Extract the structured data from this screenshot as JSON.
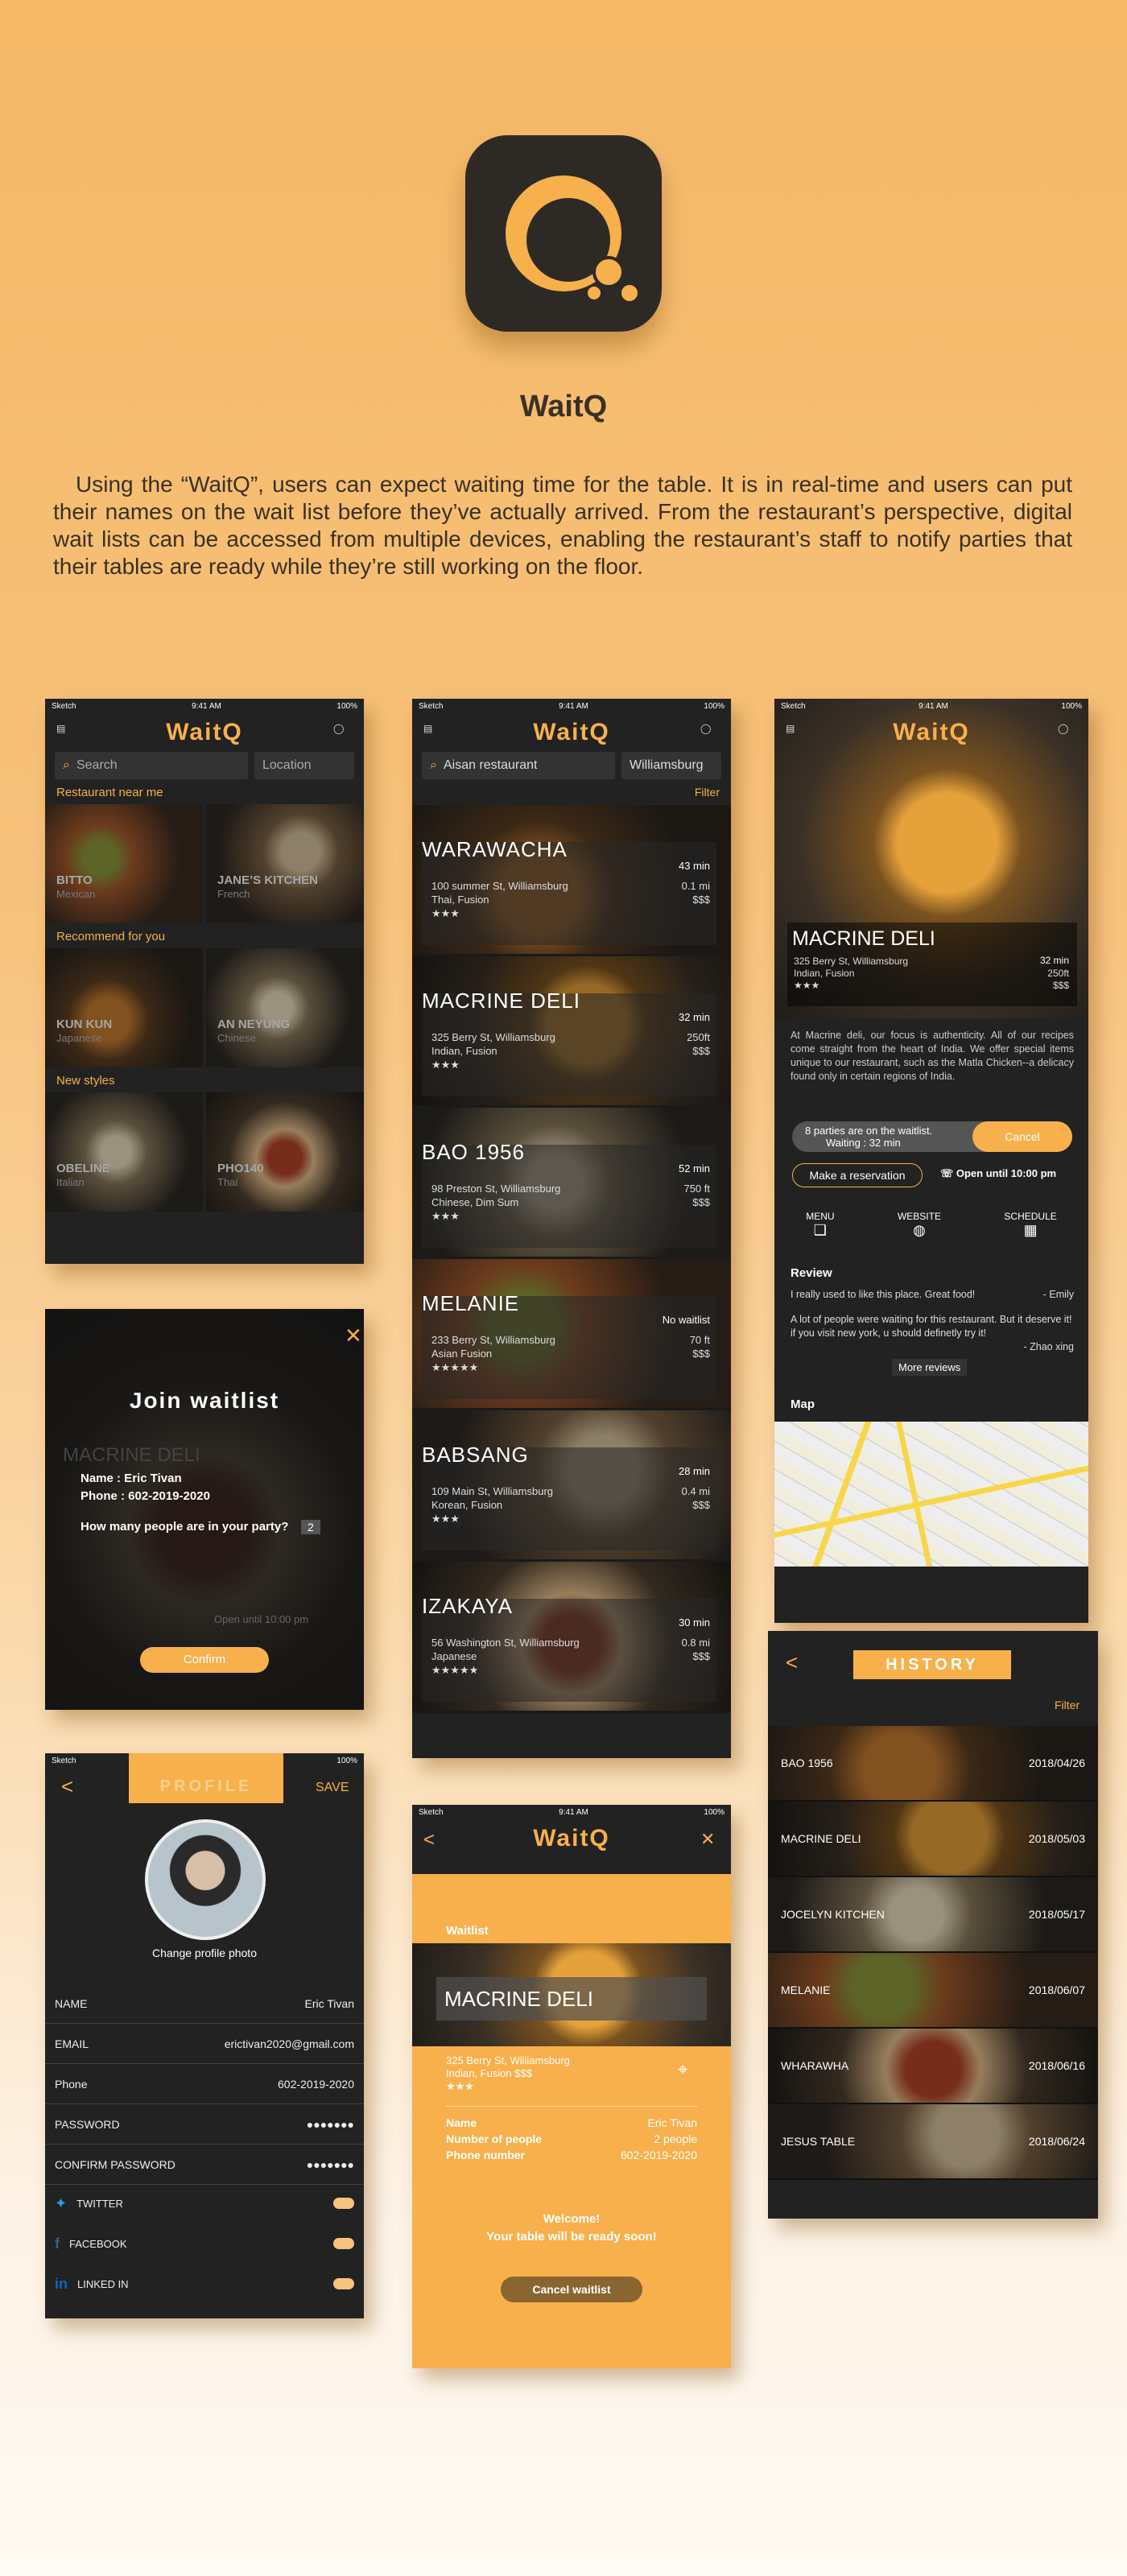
{
  "hero": {
    "app_name": "WaitQ",
    "description": "Using the “WaitQ”, users can expect waiting time for the table. It is in real-time and users can put their names on the wait list before they’ve actually arrived. From the restaurant’s perspective, digital wait lists can be accessed from multiple devices, enabling the restaurant’s staff to notify parties that their tables are ready while they’re still working on the floor."
  },
  "status": {
    "carrier": "Sketch",
    "time": "9:41 AM",
    "battery": "100%"
  },
  "home": {
    "title": "WaitQ",
    "search_placeholder": "Search",
    "location_placeholder": "Location",
    "sections": [
      {
        "label": "Restaurant near me",
        "items": [
          {
            "name": "BITTO",
            "cuisine": "Mexican"
          },
          {
            "name": "JANE’S KITCHEN",
            "cuisine": "French"
          }
        ]
      },
      {
        "label": "Recommend for you",
        "items": [
          {
            "name": "KUN KUN",
            "cuisine": "Japanese"
          },
          {
            "name": "AN NEYUNG",
            "cuisine": "Chinese"
          }
        ]
      },
      {
        "label": "New styles",
        "items": [
          {
            "name": "OBELINE",
            "cuisine": "Italian"
          },
          {
            "name": "PHO140",
            "cuisine": "Thai"
          }
        ]
      }
    ]
  },
  "list": {
    "title": "WaitQ",
    "search_value": "Aisan restaurant",
    "location_value": "Williamsburg",
    "filter": "Filter",
    "cards": [
      {
        "name": "WARAWACHA",
        "time": "43 min",
        "address": "100 summer St, Williamsburg",
        "cuisine": "Thai, Fusion",
        "distance": "0.1 mi",
        "price": "$$$",
        "stars": "★★★"
      },
      {
        "name": "MACRINE DELI",
        "time": "32 min",
        "address": "325 Berry St, Williamsburg",
        "cuisine": "Indian, Fusion",
        "distance": "250ft",
        "price": "$$$",
        "stars": "★★★"
      },
      {
        "name": "BAO 1956",
        "time": "52 min",
        "address": "98 Preston St, Williamsburg",
        "cuisine": "Chinese, Dim Sum",
        "distance": "750 ft",
        "price": "$$$",
        "stars": "★★★"
      },
      {
        "name": "MELANIE",
        "time": "No waitlist",
        "address": "233 Berry St, Williamsburg",
        "cuisine": "Asian Fusion",
        "distance": "70 ft",
        "price": "$$$",
        "stars": "★★★★★"
      },
      {
        "name": "BABSANG",
        "time": "28 min",
        "address": "109 Main St, Williamsburg",
        "cuisine": "Korean, Fusion",
        "distance": "0.4 mi",
        "price": "$$$",
        "stars": "★★★"
      },
      {
        "name": "IZAKAYA",
        "time": "30 min",
        "address": "56 Washington St, Williamsburg",
        "cuisine": "Japanese",
        "distance": "0.8 mi",
        "price": "$$$",
        "stars": "★★★★★"
      }
    ]
  },
  "detail": {
    "title": "WaitQ",
    "name": "MACRINE DELI",
    "time": "32 min",
    "address": "325 Berry St, Williamsburg",
    "cuisine": "Indian, Fusion",
    "distance": "250ft",
    "price": "$$$",
    "stars": "★★★",
    "about": "At Macrine deli, our focus is authenticity. All of our recipes come straight from the heart of India. We offer special items unique to our restaurant, such as the Matla Chicken--a delicacy found only in certain regions of India.",
    "waitlist_status": "8 parties are on the waitlist.",
    "waiting": "Waiting : 32 min",
    "cancel": "Cancel",
    "reserve": "Make a reservation",
    "open": "Open until 10:00 pm",
    "menu": "MENU",
    "website": "WEBSITE",
    "schedule": "SCHEDULE",
    "review_title": "Review",
    "reviews": [
      {
        "text": "I really used to like this place. Great food!",
        "author": "- Emily"
      },
      {
        "text": "A lot of people were waiting for this restaurant. But it deserve it! if you visit new york, u should definetly try it!",
        "author": "- Zhao xing"
      }
    ],
    "more_reviews": "More reviews",
    "map_title": "Map"
  },
  "join": {
    "title": "Join waitlist",
    "name_line": "Name : Eric Tivan",
    "phone_line": "Phone : 602-2019-2020",
    "question": "How many people are in your party?",
    "party": "2",
    "confirm": "Confirm",
    "bg_name": "MACRINE DELI",
    "bg_open": "Open until 10:00 pm"
  },
  "profile": {
    "title": "PROFILE",
    "save": "SAVE",
    "change_photo": "Change profile photo",
    "fields": [
      {
        "label": "NAME",
        "value": "Eric Tivan"
      },
      {
        "label": "EMAIL",
        "value": "erictivan2020@gmail.com"
      },
      {
        "label": "Phone",
        "value": "602-2019-2020"
      },
      {
        "label": "PASSWORD",
        "value": "●●●●●●●"
      },
      {
        "label": "CONFIRM PASSWORD",
        "value": "●●●●●●●"
      }
    ],
    "social": [
      {
        "label": "TWITTER"
      },
      {
        "label": "FACEBOOK"
      },
      {
        "label": "LINKED IN"
      }
    ]
  },
  "confirm": {
    "title": "WaitQ",
    "section": "Waitlist",
    "name": "MACRINE DELI",
    "address": "325 Berry St, Williamsburg",
    "cuisine": "Indian, Fusion  $$$",
    "stars": "★★★",
    "name_label": "Name",
    "name_value": "Eric Tivan",
    "people_label": "Number of people",
    "people_value": "2 people",
    "phone_label": "Phone number",
    "phone_value": "602-2019-2020",
    "welcome": "Welcome!",
    "ready": "Your table will be ready soon!",
    "cancel": "Cancel waitlist"
  },
  "history": {
    "title": "HISTORY",
    "filter": "Filter",
    "rows": [
      {
        "name": "BAO 1956",
        "date": "2018/04/26"
      },
      {
        "name": "MACRINE DELI",
        "date": "2018/05/03"
      },
      {
        "name": "JOCELYN KITCHEN",
        "date": "2018/05/17"
      },
      {
        "name": "MELANIE",
        "date": "2018/06/07"
      },
      {
        "name": "WHARAWHA",
        "date": "2018/06/16"
      },
      {
        "name": "JESUS TABLE",
        "date": "2018/06/24"
      }
    ]
  },
  "colors": {
    "accent": "#f7b04c",
    "dark": "#222222"
  }
}
